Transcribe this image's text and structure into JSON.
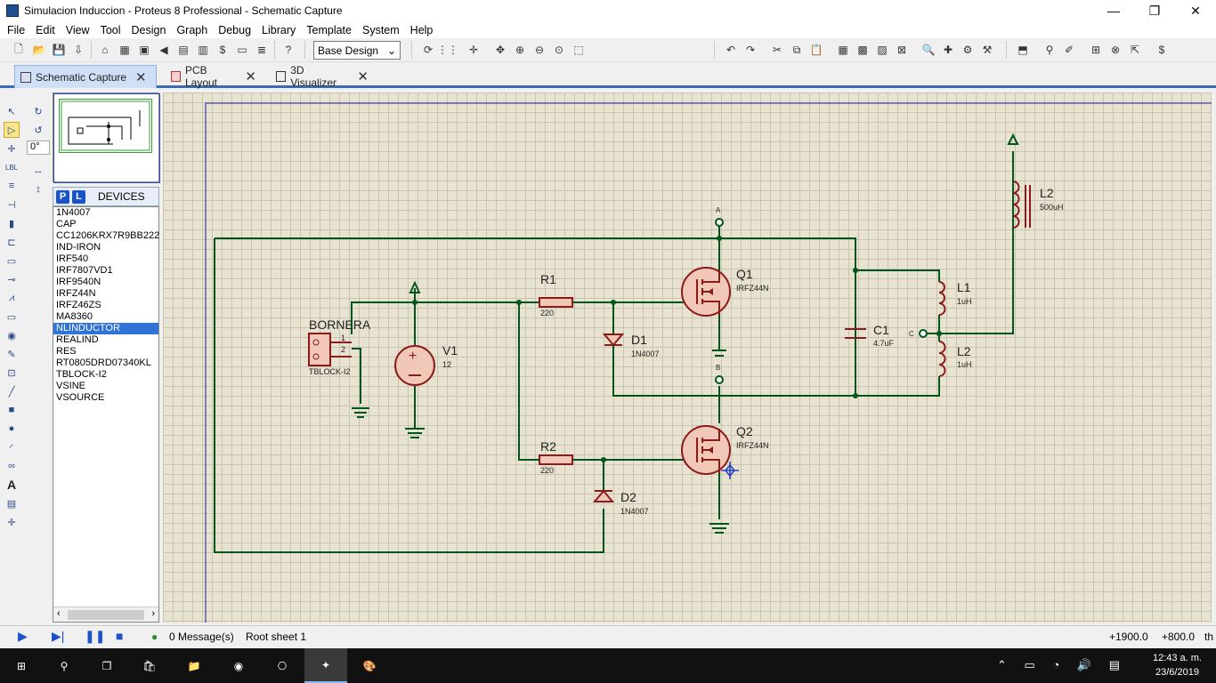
{
  "window": {
    "title": "Simulacion Induccion - Proteus 8 Professional - Schematic Capture",
    "minimize": "—",
    "restore": "❐",
    "close": "✕"
  },
  "menu": [
    "File",
    "Edit",
    "View",
    "Tool",
    "Design",
    "Graph",
    "Debug",
    "Library",
    "Template",
    "System",
    "Help"
  ],
  "toolbar": {
    "layer_select": "Base Design"
  },
  "tabs": [
    {
      "label": "Schematic Capture"
    },
    {
      "label": "PCB Layout"
    },
    {
      "label": "3D Visualizer"
    }
  ],
  "rotation": {
    "angle": "0°"
  },
  "devices": {
    "header": "DEVICES",
    "p_label": "P",
    "l_label": "L",
    "items": [
      "1N4007",
      "CAP",
      "CC1206KRX7R9BB222",
      "IND-IRON",
      "IRF540",
      "IRF7807VD1",
      "IRF9540N",
      "IRFZ44N",
      "IRFZ46ZS",
      "MA8360",
      "NLINDUCTOR",
      "REALIND",
      "RES",
      "RT0805DRD07340KL",
      "TBLOCK-I2",
      "VSINE",
      "VSOURCE"
    ],
    "selected": "NLINDUCTOR"
  },
  "schematic": {
    "bornera": {
      "name": "BORNERA",
      "part": "TBLOCK-I2",
      "pin1": "1",
      "pin2": "2"
    },
    "v1": {
      "name": "V1",
      "value": "12"
    },
    "r1": {
      "name": "R1",
      "value": "220"
    },
    "r2": {
      "name": "R2",
      "value": "220"
    },
    "d1": {
      "name": "D1",
      "value": "1N4007"
    },
    "d2": {
      "name": "D2",
      "value": "1N4007"
    },
    "q1": {
      "name": "Q1",
      "value": "IRFZ44N"
    },
    "q2": {
      "name": "Q2",
      "value": "IRFZ44N"
    },
    "c1": {
      "name": "C1",
      "value": "4.7uF"
    },
    "l1": {
      "name": "L1",
      "value": "1uH"
    },
    "l2_mid": {
      "name": "L2",
      "value": "1uH"
    },
    "l2_top": {
      "name": "L2",
      "value": "500uH"
    },
    "probe_a": "A",
    "probe_b": "B",
    "probe_c": "C"
  },
  "status": {
    "messages": "0 Message(s)",
    "sheet": "Root sheet 1",
    "x": "+1900.0",
    "y": "+800.0",
    "unit": "th"
  },
  "taskbar": {
    "time": "12:43 a. m.",
    "date": "23/6/2019"
  }
}
